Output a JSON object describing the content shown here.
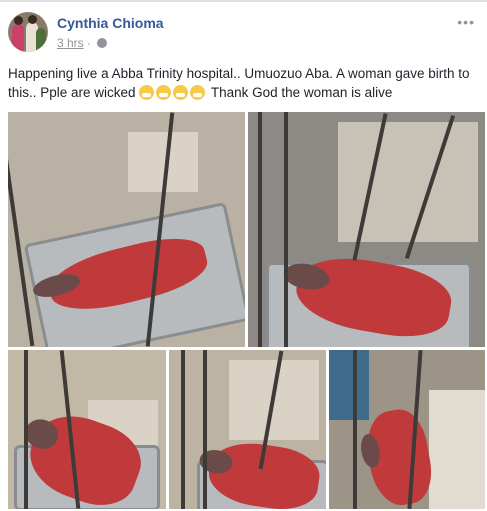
{
  "post": {
    "author": "Cynthia Chioma",
    "time": "3 hrs",
    "privacy_icon": "globe-icon",
    "menu_icon": "more-icon",
    "text_before_emoji": "Happening live a Abba Trinity hospital.. Umuozuo Aba. A woman gave birth to this.. Pple are wicked",
    "emoji_name": "face-with-medical-mask",
    "emoji_count": 4,
    "text_after_emoji": "Thank God the woman is alive"
  },
  "colors": {
    "author_link": "#365899",
    "meta_text": "#90949c",
    "body_text": "#1d2129"
  },
  "photos": [
    {
      "name": "photo-1",
      "subject": "tray-with-newborn"
    },
    {
      "name": "photo-2",
      "subject": "tray-with-newborn"
    },
    {
      "name": "photo-3",
      "subject": "tray-with-newborn"
    },
    {
      "name": "photo-4",
      "subject": "tray-with-newborn"
    },
    {
      "name": "photo-5",
      "subject": "tray-with-newborn"
    }
  ]
}
